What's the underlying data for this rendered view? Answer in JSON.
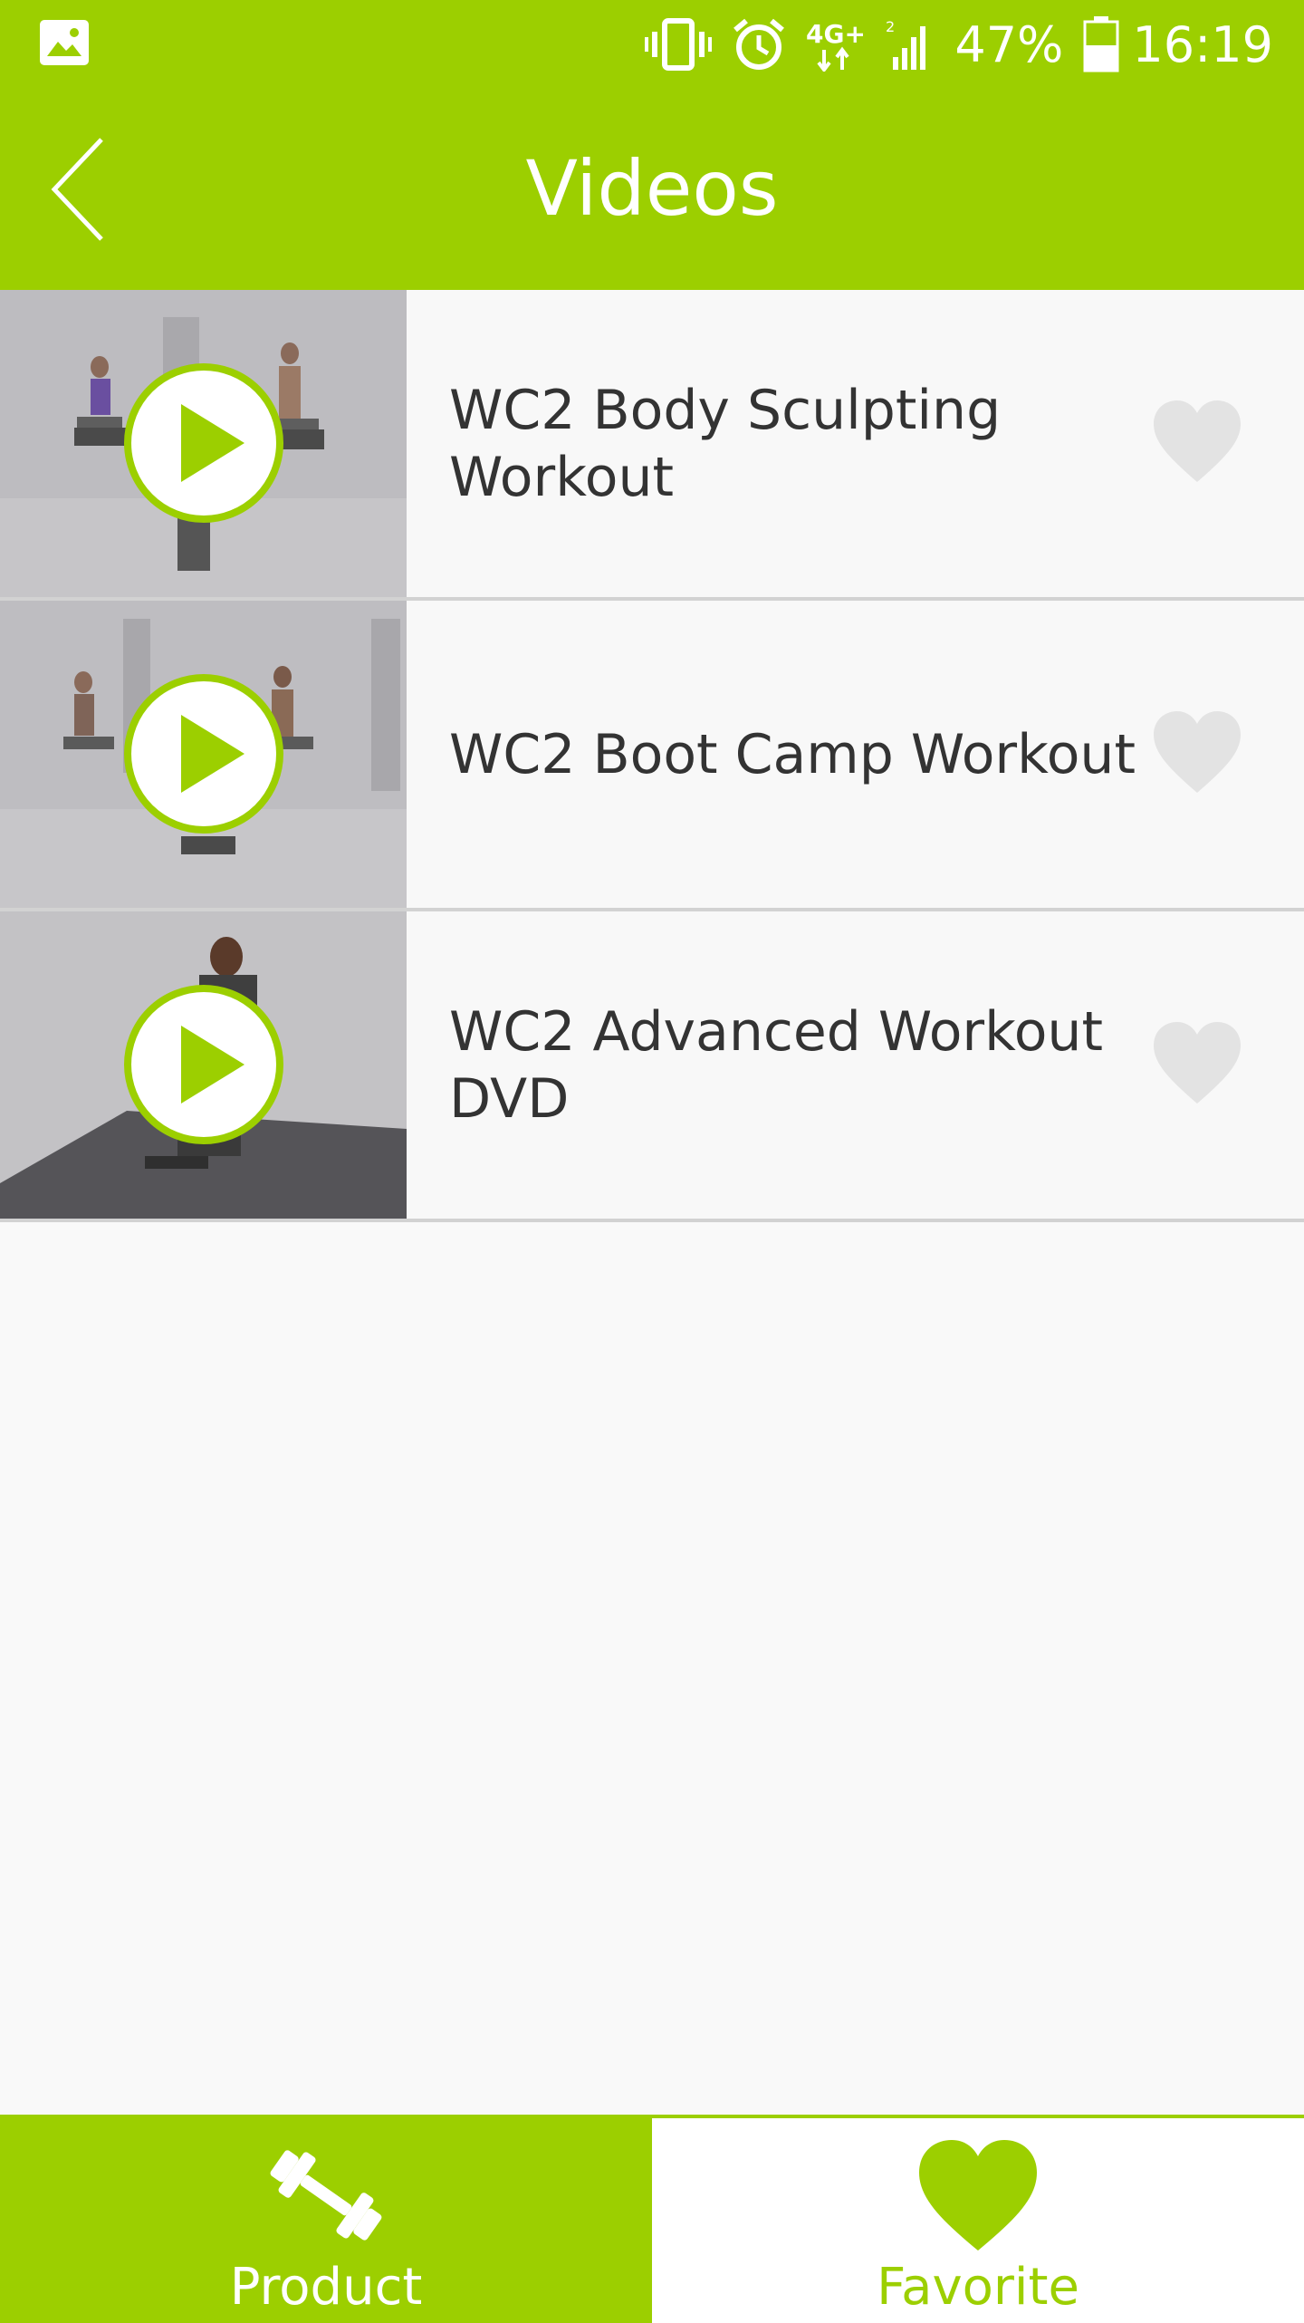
{
  "status_bar": {
    "battery_percent": "47%",
    "time": "16:19",
    "network": "4G+",
    "icons": [
      "gallery-icon",
      "vibrate-icon",
      "alarm-icon",
      "network-4g-icon",
      "signal-icon",
      "battery-icon"
    ]
  },
  "app_bar": {
    "title": "Videos",
    "back_icon": "chevron-left-icon"
  },
  "videos": [
    {
      "title": "WC2 Body Sculpting Workout"
    },
    {
      "title": "WC2 Boot Camp Workout"
    },
    {
      "title": "WC2 Advanced Workout DVD"
    }
  ],
  "tabs": [
    {
      "label": "Product",
      "icon": "dumbbell-icon",
      "active": false
    },
    {
      "label": "Favorite",
      "icon": "heart-icon",
      "active": true
    }
  ],
  "colors": {
    "brand": "#9ccf00",
    "play_fill": "#9ccf00",
    "heart_inactive": "#e2e2e2",
    "text": "#333333"
  }
}
